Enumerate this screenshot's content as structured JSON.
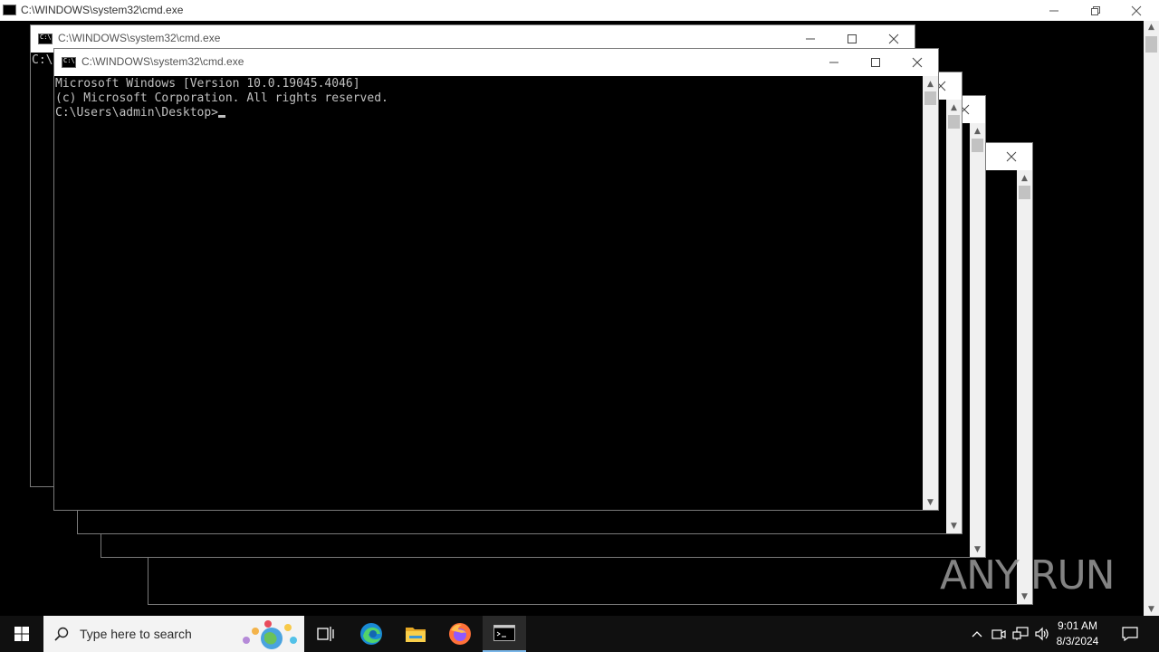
{
  "background_window": {
    "title": "C:\\WINDOWS\\system32\\cmd.exe",
    "line": "C:\\"
  },
  "front_window": {
    "title": "C:\\WINDOWS\\system32\\cmd.exe",
    "lines": [
      "Microsoft Windows [Version 10.0.19045.4046]",
      "(c) Microsoft Corporation. All rights reserved.",
      "",
      "C:\\Users\\admin\\Desktop>"
    ]
  },
  "taskbar": {
    "search_placeholder": "Type here to search",
    "time": "9:01 AM",
    "date": "8/3/2024",
    "icons": [
      "windows-start-icon",
      "search-icon",
      "task-view-icon",
      "edge-icon",
      "file-explorer-icon",
      "firefox-icon",
      "cmd-icon",
      "chevron-up-icon",
      "network-icon",
      "volume-icon",
      "notification-icon"
    ]
  },
  "watermark": "ANY RUN",
  "colors": {
    "console_bg": "#000000",
    "console_text": "#c0c0c0",
    "taskbar_bg": "#101010"
  }
}
